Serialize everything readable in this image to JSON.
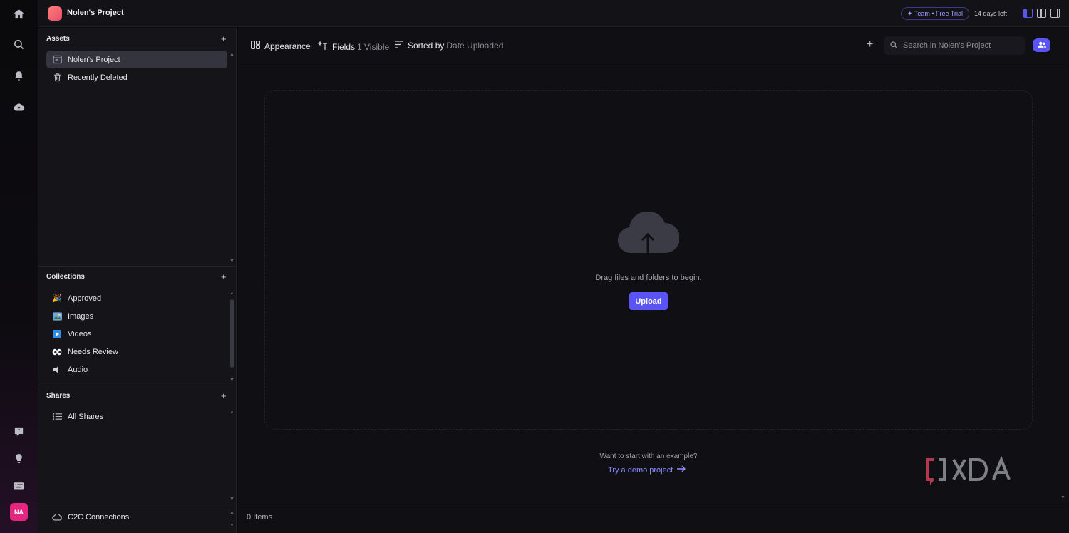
{
  "topbar": {
    "project_name": "Nolen's Project",
    "trial_badge": "✦ Team • Free Trial",
    "days_left": "14 days left"
  },
  "sidebar": {
    "assets_header": "Assets",
    "assets_items": [
      {
        "label": "Nolen's Project"
      },
      {
        "label": "Recently Deleted"
      }
    ],
    "collections_header": "Collections",
    "collections_items": [
      {
        "label": "Approved"
      },
      {
        "label": "Images"
      },
      {
        "label": "Videos"
      },
      {
        "label": "Needs Review"
      },
      {
        "label": "Audio"
      }
    ],
    "shares_header": "Shares",
    "shares_items": [
      {
        "label": "All Shares"
      }
    ],
    "c2c_label": "C2C Connections"
  },
  "toolbar": {
    "appearance": "Appearance",
    "fields": "Fields",
    "fields_count": "1 Visible",
    "sorted_by": "Sorted by",
    "sorted_value": "Date Uploaded",
    "search_placeholder": "Search in Nolen's Project"
  },
  "empty_state": {
    "drag_text": "Drag files and folders to begin.",
    "upload_label": "Upload",
    "example_question": "Want to start with an example?",
    "demo_link": "Try a demo project"
  },
  "footer": {
    "items_count": "0 Items"
  },
  "user": {
    "initials": "NA"
  },
  "colors": {
    "accent": "#5b54f5",
    "avatar": "#e5257e",
    "link": "#8b8dff"
  }
}
